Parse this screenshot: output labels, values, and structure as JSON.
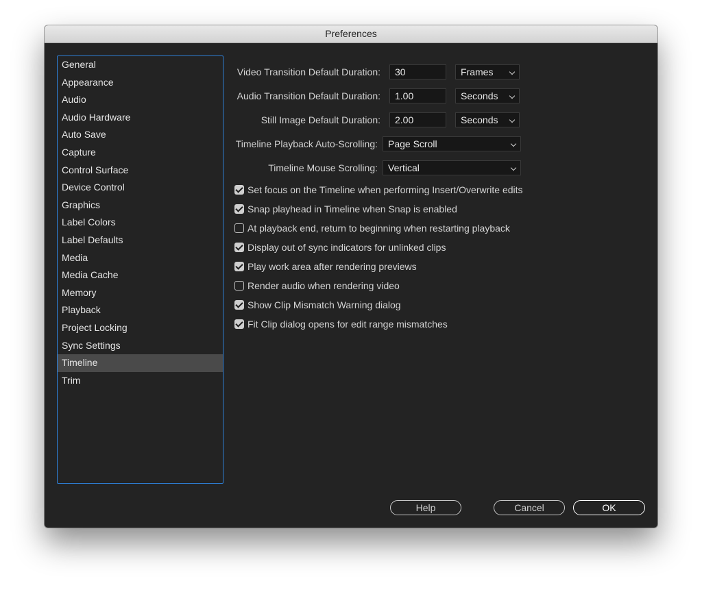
{
  "window": {
    "title": "Preferences"
  },
  "sidebar": {
    "items": [
      {
        "label": "General"
      },
      {
        "label": "Appearance"
      },
      {
        "label": "Audio"
      },
      {
        "label": "Audio Hardware"
      },
      {
        "label": "Auto Save"
      },
      {
        "label": "Capture"
      },
      {
        "label": "Control Surface"
      },
      {
        "label": "Device Control"
      },
      {
        "label": "Graphics"
      },
      {
        "label": "Label Colors"
      },
      {
        "label": "Label Defaults"
      },
      {
        "label": "Media"
      },
      {
        "label": "Media Cache"
      },
      {
        "label": "Memory"
      },
      {
        "label": "Playback"
      },
      {
        "label": "Project Locking"
      },
      {
        "label": "Sync Settings"
      },
      {
        "label": "Timeline",
        "selected": true
      },
      {
        "label": "Trim"
      }
    ]
  },
  "fields": {
    "video_transition": {
      "label": "Video Transition Default Duration:",
      "value": "30",
      "unit": "Frames"
    },
    "audio_transition": {
      "label": "Audio Transition Default Duration:",
      "value": "1.00",
      "unit": "Seconds"
    },
    "still_image": {
      "label": "Still Image Default Duration:",
      "value": "2.00",
      "unit": "Seconds"
    },
    "auto_scrolling": {
      "label": "Timeline Playback Auto-Scrolling:",
      "value": "Page Scroll"
    },
    "mouse_scrolling": {
      "label": "Timeline Mouse Scrolling:",
      "value": "Vertical"
    }
  },
  "checkboxes": [
    {
      "label": "Set focus on the Timeline when performing Insert/Overwrite edits",
      "checked": true
    },
    {
      "label": "Snap playhead in Timeline when Snap is enabled",
      "checked": true
    },
    {
      "label": "At playback end, return to beginning when restarting playback",
      "checked": false
    },
    {
      "label": "Display out of sync indicators for unlinked clips",
      "checked": true
    },
    {
      "label": "Play work area after rendering previews",
      "checked": true
    },
    {
      "label": "Render audio when rendering video",
      "checked": false
    },
    {
      "label": "Show Clip Mismatch Warning dialog",
      "checked": true
    },
    {
      "label": "Fit Clip dialog opens for edit range mismatches",
      "checked": true
    }
  ],
  "buttons": {
    "help": "Help",
    "cancel": "Cancel",
    "ok": "OK"
  },
  "colors": {
    "accent": "#2e7fd6",
    "background": "#232323",
    "selected": "#4a4a4a"
  }
}
